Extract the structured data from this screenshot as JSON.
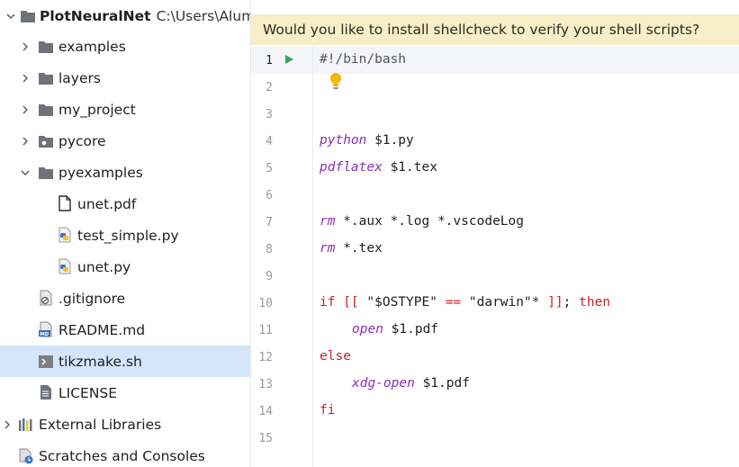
{
  "project_tree": {
    "root": {
      "name": "PlotNeuralNet",
      "path": "C:\\Users\\Alumini"
    },
    "items": [
      {
        "label": "examples",
        "type": "folder"
      },
      {
        "label": "layers",
        "type": "folder"
      },
      {
        "label": "my_project",
        "type": "folder"
      },
      {
        "label": "pycore",
        "type": "package-folder"
      },
      {
        "label": "pyexamples",
        "type": "folder",
        "expanded": true
      },
      {
        "label": "unet.pdf",
        "type": "pdf-file"
      },
      {
        "label": "test_simple.py",
        "type": "python-file"
      },
      {
        "label": "unet.py",
        "type": "python-file"
      },
      {
        "label": ".gitignore",
        "type": "gitignore-file"
      },
      {
        "label": "README.md",
        "type": "markdown-file"
      },
      {
        "label": "tikzmake.sh",
        "type": "shell-file",
        "selected": true
      },
      {
        "label": "LICENSE",
        "type": "text-file"
      },
      {
        "label": "External Libraries",
        "type": "libraries"
      },
      {
        "label": "Scratches and Consoles",
        "type": "scratches"
      }
    ]
  },
  "editor": {
    "banner": "Would you like to install shellcheck to verify your shell scripts?",
    "line_numbers": [
      "1",
      "2",
      "3",
      "4",
      "5",
      "6",
      "7",
      "8",
      "9",
      "10",
      "11",
      "12",
      "13",
      "14",
      "15"
    ],
    "lines": {
      "l1": "#!/bin/bash",
      "l4_cmd": "python",
      "l4_rest": " $1.py",
      "l5_cmd": "pdflatex",
      "l5_rest": " $1.tex",
      "l7_cmd": "rm",
      "l7_rest": " *.aux *.log *.vscodeLog",
      "l8_cmd": "rm",
      "l8_rest": " *.tex",
      "l10_if": "if",
      "l10_open": " [[ ",
      "l10_str1": "\"$OSTYPE\"",
      "l10_eq": " == ",
      "l10_str2": "\"darwin\"*",
      "l10_close": " ]]",
      "l10_semi": "; ",
      "l10_then": "then",
      "l11_cmd": "open",
      "l11_rest": " $1.pdf",
      "l12_else": "else",
      "l13_cmd": "xdg-open",
      "l13_rest": " $1.pdf",
      "l14_fi": "fi"
    }
  },
  "colors": {
    "selection": "#d5e6fb",
    "banner_bg": "#f6efc7",
    "keyword": "#c8212a",
    "command": "#8a2fb8",
    "run_icon": "#3aa757",
    "bulb": "#f5b800"
  }
}
